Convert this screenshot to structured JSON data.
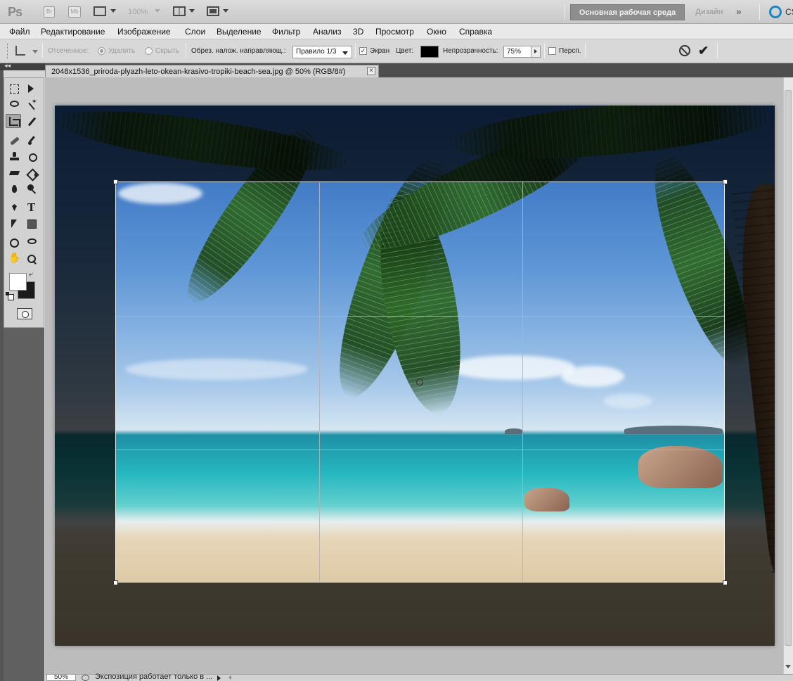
{
  "appbar": {
    "logo": "Ps",
    "bridge_label": "Br",
    "minibridge_label": "Mb",
    "zoom": "100%",
    "workspace_button": "Основная рабочая среда",
    "design_link": "Дизайн",
    "more": "»",
    "cs_live_label": "CS"
  },
  "menu": {
    "items": [
      "Файл",
      "Редактирование",
      "Изображение",
      "Слои",
      "Выделение",
      "Фильтр",
      "Анализ",
      "3D",
      "Просмотр",
      "Окно",
      "Справка"
    ]
  },
  "options": {
    "cropped_label": "Отсеченное:",
    "delete_label": "Удалить",
    "hide_label": "Скрыть",
    "overlay_label": "Обрез. налож. направляющ.:",
    "guide_value": "Правило 1/3",
    "shield_label": "Экран",
    "shield_checked": true,
    "color_label": "Цвет:",
    "shield_color": "#000000",
    "opacity_label": "Непрозрачность:",
    "opacity_value": "75%",
    "perspective_label": "Персп.",
    "perspective_checked": false,
    "cancel_icon": "cancel-icon",
    "commit_icon": "checkmark-icon"
  },
  "tools": {
    "panel_collapse": "◂◂",
    "active": "crop-tool",
    "foreground_color": "#ffffff",
    "background_color": "#1a1a1a"
  },
  "document": {
    "tab_title": "2048x1536_priroda-plyazh-leto-okean-krasivo-tropiki-beach-sea.jpg @ 50% (RGB/8#)",
    "close": "×"
  },
  "status": {
    "zoom": "50%",
    "text": "Экспозиция работает только в ..."
  }
}
